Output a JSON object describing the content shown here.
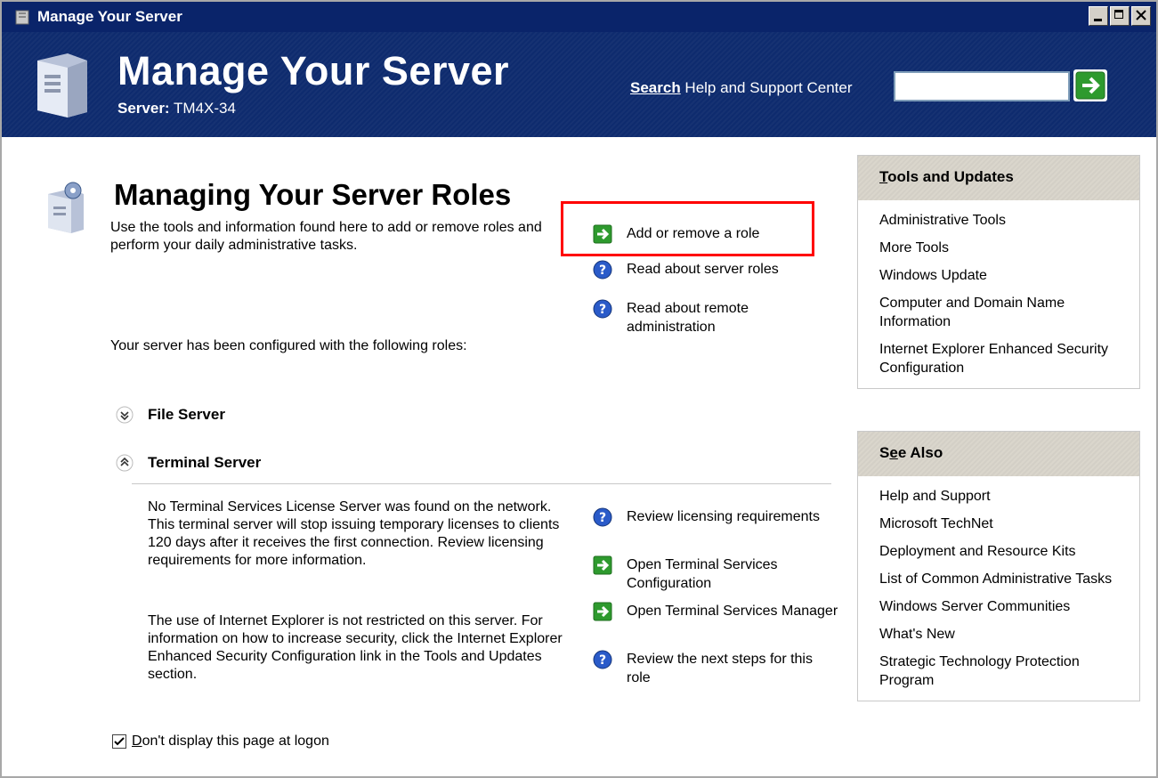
{
  "window": {
    "title": "Manage Your Server",
    "controls": [
      "minimize",
      "maximize",
      "close"
    ]
  },
  "header": {
    "title": "Manage Your Server",
    "server_label": "Server:",
    "server_name": "TM4X-34",
    "search_label_bold": "Search",
    "search_label_rest": " Help and Support Center",
    "search_value": "",
    "go_icon": "green-arrow-icon"
  },
  "main": {
    "title": "Managing Your Server Roles",
    "description": "Use the tools and information found here to add or remove roles and perform your daily administrative tasks.",
    "actions": [
      {
        "label": "Add or remove a role",
        "icon": "green-arrow-icon"
      },
      {
        "label": "Read about server roles",
        "icon": "help-icon"
      },
      {
        "label": "Read about remote administration",
        "icon": "help-icon"
      }
    ],
    "configured_text": "Your server has been configured with the following roles:",
    "roles": [
      {
        "name": "File Server",
        "state": "collapsed"
      },
      {
        "name": "Terminal Server",
        "state": "expanded"
      }
    ],
    "terminal_desc_1": "No Terminal Services License Server was found on the network. This terminal server will stop issuing temporary licenses to clients 120 days after it receives the first connection. Review licensing requirements for more information.",
    "terminal_desc_2": "The use of Internet Explorer is not restricted on this server. For information on how to increase security, click the Internet Explorer Enhanced Security Configuration link in the Tools and Updates section.",
    "terminal_actions": [
      {
        "label": "Review licensing requirements",
        "icon": "help-icon"
      },
      {
        "label": "Open Terminal Services Configuration",
        "icon": "green-arrow-icon"
      },
      {
        "label": "Open Terminal Services Manager",
        "icon": "green-arrow-icon"
      },
      {
        "label": "Review the next steps for this role",
        "icon": "help-icon"
      }
    ],
    "checkbox_underlined": "D",
    "checkbox_rest": "on't display this page at logon",
    "checkbox_checked": true
  },
  "tools_panel": {
    "title_underlined": "T",
    "title_rest": "ools and Updates",
    "links": [
      "Administrative Tools",
      "More Tools",
      "Windows Update",
      "Computer and Domain Name Information",
      "Internet Explorer Enhanced Security Configuration"
    ]
  },
  "see_also_panel": {
    "title_pre": "S",
    "title_underlined": "e",
    "title_rest": "e Also",
    "links": [
      "Help and Support",
      "Microsoft TechNet",
      "Deployment and Resource Kits",
      "List of Common Administrative Tasks",
      "Windows Server Communities",
      "What's New",
      "Strategic Technology Protection Program"
    ]
  },
  "colors": {
    "header_bg": "#0e2b6e",
    "highlight_border": "#ff0000",
    "go_green": "#2e9a2e",
    "help_blue": "#2a5bc9"
  }
}
